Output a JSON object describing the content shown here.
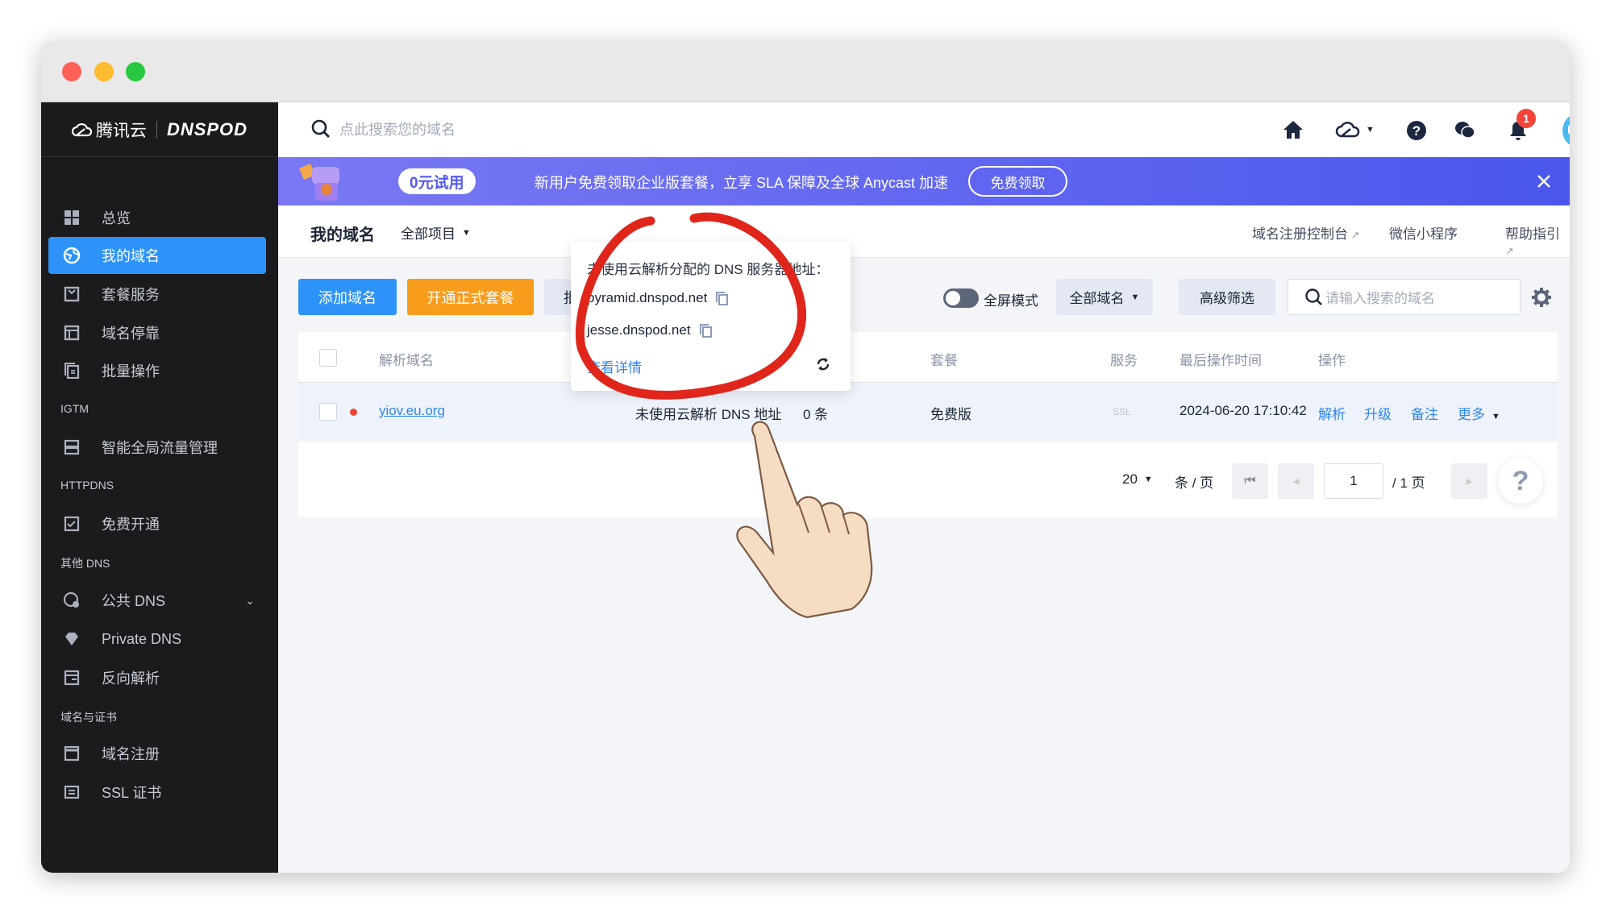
{
  "sidebar": {
    "logo_cn": "腾讯云",
    "logo_en": "DNSPOD",
    "items": [
      {
        "label": "总览"
      },
      {
        "label": "我的域名"
      },
      {
        "label": "套餐服务"
      },
      {
        "label": "域名停靠"
      },
      {
        "label": "批量操作"
      },
      {
        "section": "IGTM"
      },
      {
        "label": "智能全局流量管理"
      },
      {
        "section": "HTTPDNS"
      },
      {
        "label": "免费开通"
      },
      {
        "section": "其他 DNS"
      },
      {
        "label": "公共 DNS"
      },
      {
        "label": "Private DNS"
      },
      {
        "label": "反向解析"
      },
      {
        "section": "域名与证书"
      },
      {
        "label": "域名注册"
      },
      {
        "label": "SSL 证书"
      }
    ]
  },
  "topbar": {
    "search_placeholder": "点此搜索您的域名",
    "notification_count": "1"
  },
  "banner": {
    "badge": "0元试用",
    "text": "新用户免费领取企业版套餐，立享 SLA 保障及全球 Anycast 加速",
    "button": "免费领取"
  },
  "subheader": {
    "title": "我的域名",
    "project_filter": "全部项目",
    "links": [
      "域名注册控制台",
      "微信小程序",
      "帮助指引"
    ]
  },
  "toolbar": {
    "add_domain": "添加域名",
    "open_plan": "开通正式套餐",
    "partial_button": "批",
    "fullscreen_label": "全屏模式",
    "domain_filter": "全部域名",
    "advanced_filter": "高级筛选",
    "search_placeholder": "请输入搜索的域名"
  },
  "table": {
    "headers": {
      "domain": "解析域名",
      "plan": "套餐",
      "service": "服务",
      "last_op": "最后操作时间",
      "actions": "操作"
    },
    "rows": [
      {
        "domain": "yiov.eu.org",
        "status": "未使用云解析 DNS 地址",
        "records": "0 条",
        "plan": "免费版",
        "service": "SSL",
        "last_op": "2024-06-20 17:10:42",
        "actions": [
          "解析",
          "升级",
          "备注",
          "更多"
        ]
      }
    ]
  },
  "pagination": {
    "page_size": "20",
    "per_page_label": "条 / 页",
    "current_page": "1",
    "total_label": "/ 1 页"
  },
  "popup": {
    "title": "未使用云解析分配的 DNS 服务器地址：",
    "servers": [
      "pyramid.dnspod.net",
      "jesse.dnspod.net"
    ],
    "details_link": "查看详情"
  },
  "colors": {
    "primary": "#2e93f8",
    "orange": "#f89c1c",
    "banner": "#5b60ef",
    "annotation": "#e0261b"
  }
}
